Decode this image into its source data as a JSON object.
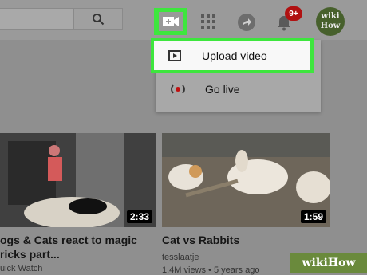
{
  "header": {
    "create_icon": "video-camera-plus-icon",
    "apps_icon": "apps-grid-icon",
    "share_icon": "share-icon",
    "bell_icon": "bell-icon",
    "notification_count": "9+",
    "avatar_text_top": "wiki",
    "avatar_text_bottom": "How"
  },
  "menu": {
    "items": [
      {
        "label": "Upload video",
        "icon": "upload-video-icon"
      },
      {
        "label": "Go live",
        "icon": "go-live-icon"
      }
    ]
  },
  "videos": [
    {
      "title_line1": "ogs & Cats react to magic",
      "title_line2": "ricks part...",
      "channel": "uick Watch",
      "duration": "2:33"
    },
    {
      "title_line1": "Cat vs Rabbits",
      "channel": "tesslaatje",
      "stats": "1.4M views • 5 years ago",
      "duration": "1:59"
    }
  ],
  "watermark": "wikiHow",
  "colors": {
    "highlight": "#3ee63e",
    "badge": "#b01111"
  }
}
